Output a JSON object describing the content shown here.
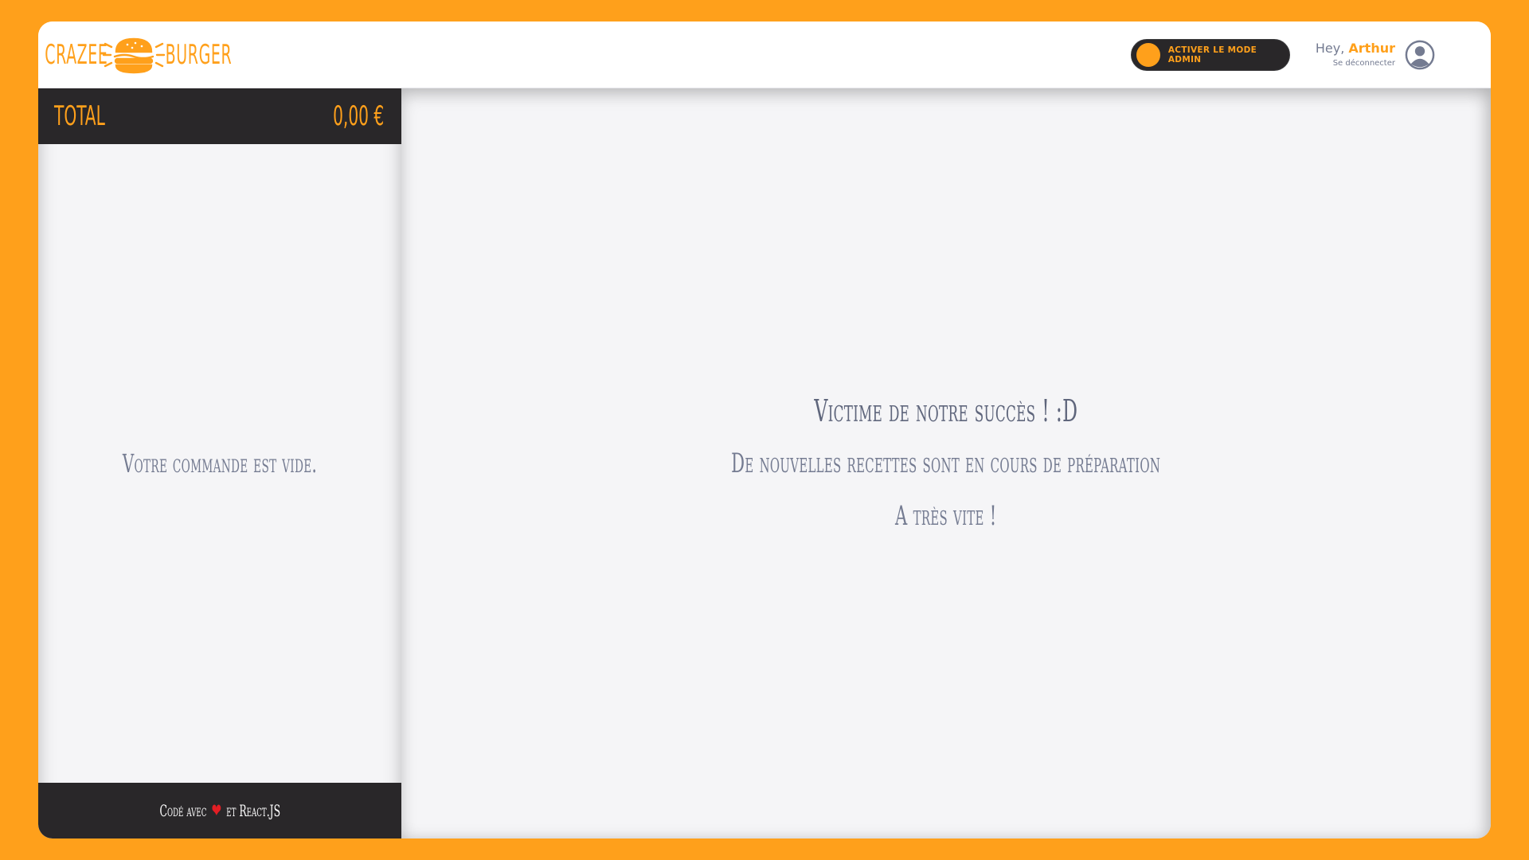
{
  "brand": {
    "name_left": "Crazee",
    "name_right": "Burger",
    "accent_color": "#FFA01B",
    "dark_color": "#292729",
    "text_color": "#747b91"
  },
  "navbar": {
    "admin_toggle_label": "Activer le mode admin",
    "greeting_prefix": "Hey,",
    "username": "Arthur",
    "logout_label": "Se déconnecter",
    "avatar_icon": "user-circle-icon"
  },
  "basket": {
    "total_label": "Total",
    "total_value": "0,00 €",
    "empty_message": "Votre commande est vide.",
    "footer_prefix": "Codé avec",
    "footer_icon": "heart-icon",
    "footer_suffix": "et React.JS"
  },
  "menu": {
    "empty_title": "Victime de notre succès ! :D",
    "empty_line_1": "De nouvelles recettes sont en cours de préparation",
    "empty_line_2": "A très vite !"
  }
}
